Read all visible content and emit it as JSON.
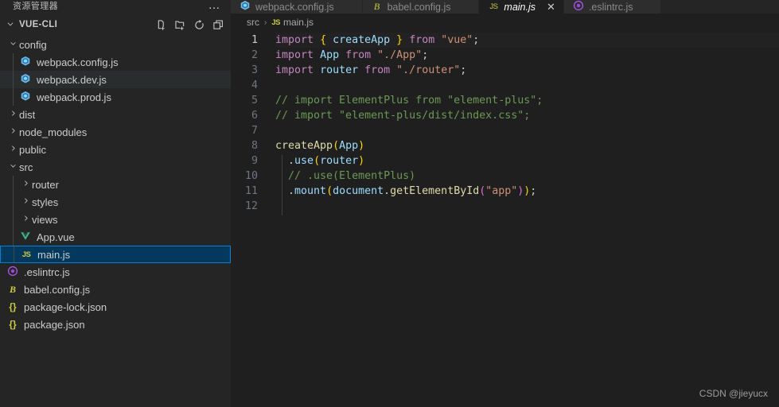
{
  "sidebar": {
    "title": "资源管理器",
    "more_label": "…",
    "project": {
      "name": "VUE-CLI",
      "expanded": true
    },
    "actions": [
      {
        "name": "new-file-icon",
        "label": "New File"
      },
      {
        "name": "new-folder-icon",
        "label": "New Folder"
      },
      {
        "name": "refresh-icon",
        "label": "Refresh Explorer"
      },
      {
        "name": "collapse-all-icon",
        "label": "Collapse Folders in Explorer"
      }
    ],
    "items": [
      {
        "label": "config",
        "type": "folder",
        "icon": "chevron-down",
        "depth": 1,
        "expanded": true,
        "state": "normal"
      },
      {
        "label": "webpack.config.js",
        "type": "file",
        "icon": "webpack",
        "depth": 2,
        "state": "normal"
      },
      {
        "label": "webpack.dev.js",
        "type": "file",
        "icon": "webpack",
        "depth": 2,
        "state": "hover"
      },
      {
        "label": "webpack.prod.js",
        "type": "file",
        "icon": "webpack",
        "depth": 2,
        "state": "normal"
      },
      {
        "label": "dist",
        "type": "folder",
        "icon": "chevron-right",
        "depth": 1,
        "expanded": false,
        "state": "normal"
      },
      {
        "label": "node_modules",
        "type": "folder",
        "icon": "chevron-right",
        "depth": 1,
        "expanded": false,
        "state": "normal"
      },
      {
        "label": "public",
        "type": "folder",
        "icon": "chevron-right",
        "depth": 1,
        "expanded": false,
        "state": "normal"
      },
      {
        "label": "src",
        "type": "folder",
        "icon": "chevron-down",
        "depth": 1,
        "expanded": true,
        "state": "normal"
      },
      {
        "label": "router",
        "type": "folder",
        "icon": "chevron-right",
        "depth": 2,
        "expanded": false,
        "state": "normal"
      },
      {
        "label": "styles",
        "type": "folder",
        "icon": "chevron-right",
        "depth": 2,
        "expanded": false,
        "state": "normal"
      },
      {
        "label": "views",
        "type": "folder",
        "icon": "chevron-right",
        "depth": 2,
        "expanded": false,
        "state": "normal"
      },
      {
        "label": "App.vue",
        "type": "file",
        "icon": "vue",
        "depth": 2,
        "state": "normal"
      },
      {
        "label": "main.js",
        "type": "file",
        "icon": "js",
        "depth": 2,
        "state": "selected"
      },
      {
        "label": ".eslintrc.js",
        "type": "file",
        "icon": "eslint",
        "depth": 1,
        "state": "normal"
      },
      {
        "label": "babel.config.js",
        "type": "file",
        "icon": "babel",
        "depth": 1,
        "state": "normal"
      },
      {
        "label": "package-lock.json",
        "type": "file",
        "icon": "json",
        "depth": 1,
        "state": "normal"
      },
      {
        "label": "package.json",
        "type": "file",
        "icon": "json",
        "depth": 1,
        "state": "normal"
      }
    ]
  },
  "tabs": [
    {
      "label": "webpack.config.js",
      "icon": "webpack",
      "active": false,
      "italic": false
    },
    {
      "label": "babel.config.js",
      "icon": "babel",
      "active": false,
      "italic": false
    },
    {
      "label": "main.js",
      "icon": "js",
      "active": true,
      "italic": true
    },
    {
      "label": ".eslintrc.js",
      "icon": "eslint",
      "active": false,
      "italic": false
    }
  ],
  "breadcrumb": {
    "folder": "src",
    "separator": "›",
    "file_icon_label": "JS",
    "file": "main.js"
  },
  "editor": {
    "filename": "main.js",
    "language": "javascript",
    "current_line": 1,
    "line_numbers": [
      "1",
      "2",
      "3",
      "4",
      "5",
      "6",
      "7",
      "8",
      "9",
      "10",
      "11",
      "12"
    ],
    "code_lines": [
      {
        "n": 1,
        "tokens": [
          {
            "t": "import",
            "c": "t-kw"
          },
          {
            "t": " ",
            "c": "t-punc"
          },
          {
            "t": "{",
            "c": "t-brace"
          },
          {
            "t": " ",
            "c": "t-punc"
          },
          {
            "t": "createApp",
            "c": "t-var"
          },
          {
            "t": " ",
            "c": "t-punc"
          },
          {
            "t": "}",
            "c": "t-brace"
          },
          {
            "t": " ",
            "c": "t-punc"
          },
          {
            "t": "from",
            "c": "t-from"
          },
          {
            "t": " ",
            "c": "t-punc"
          },
          {
            "t": "\"vue\"",
            "c": "t-str"
          },
          {
            "t": ";",
            "c": "t-semi"
          }
        ]
      },
      {
        "n": 2,
        "tokens": [
          {
            "t": "import",
            "c": "t-kw"
          },
          {
            "t": " ",
            "c": "t-punc"
          },
          {
            "t": "App",
            "c": "t-var"
          },
          {
            "t": " ",
            "c": "t-punc"
          },
          {
            "t": "from",
            "c": "t-from"
          },
          {
            "t": " ",
            "c": "t-punc"
          },
          {
            "t": "\"./App\"",
            "c": "t-str"
          },
          {
            "t": ";",
            "c": "t-semi"
          }
        ]
      },
      {
        "n": 3,
        "tokens": [
          {
            "t": "import",
            "c": "t-kw"
          },
          {
            "t": " ",
            "c": "t-punc"
          },
          {
            "t": "router",
            "c": "t-var"
          },
          {
            "t": " ",
            "c": "t-punc"
          },
          {
            "t": "from",
            "c": "t-from"
          },
          {
            "t": " ",
            "c": "t-punc"
          },
          {
            "t": "\"./router\"",
            "c": "t-str"
          },
          {
            "t": ";",
            "c": "t-semi"
          }
        ]
      },
      {
        "n": 4,
        "tokens": []
      },
      {
        "n": 5,
        "tokens": [
          {
            "t": "// import ElementPlus from \"element-plus\";",
            "c": "t-comment"
          }
        ]
      },
      {
        "n": 6,
        "tokens": [
          {
            "t": "// import \"element-plus/dist/index.css\";",
            "c": "t-comment"
          }
        ]
      },
      {
        "n": 7,
        "tokens": []
      },
      {
        "n": 8,
        "tokens": [
          {
            "t": "createApp",
            "c": "t-func"
          },
          {
            "t": "(",
            "c": "t-brace"
          },
          {
            "t": "App",
            "c": "t-var"
          },
          {
            "t": ")",
            "c": "t-brace"
          }
        ]
      },
      {
        "n": 9,
        "tokens": [
          {
            "t": "  .",
            "c": "t-punc"
          },
          {
            "t": "use",
            "c": "t-prop"
          },
          {
            "t": "(",
            "c": "t-brace"
          },
          {
            "t": "router",
            "c": "t-var"
          },
          {
            "t": ")",
            "c": "t-brace"
          }
        ]
      },
      {
        "n": 10,
        "tokens": [
          {
            "t": "  // .use(ElementPlus)",
            "c": "t-comment"
          }
        ]
      },
      {
        "n": 11,
        "tokens": [
          {
            "t": "  .",
            "c": "t-punc"
          },
          {
            "t": "mount",
            "c": "t-prop"
          },
          {
            "t": "(",
            "c": "t-brace"
          },
          {
            "t": "document",
            "c": "t-var"
          },
          {
            "t": ".",
            "c": "t-punc"
          },
          {
            "t": "getElementById",
            "c": "t-func"
          },
          {
            "t": "(",
            "c": "t-brace2"
          },
          {
            "t": "\"app\"",
            "c": "t-str"
          },
          {
            "t": ")",
            "c": "t-brace2"
          },
          {
            "t": ")",
            "c": "t-brace"
          },
          {
            "t": ";",
            "c": "t-semi"
          }
        ]
      },
      {
        "n": 12,
        "tokens": []
      }
    ]
  },
  "watermark": "CSDN @jieyucx",
  "colors": {
    "sidebar_bg": "#252526",
    "editor_bg": "#1f1f1f",
    "tab_inactive_bg": "#2d2d2d",
    "selection_bg": "#04395e",
    "selection_border": "#007fd4",
    "hover_bg": "#2a2d2e",
    "keyword": "#c586c0",
    "variable": "#9cdcfe",
    "string": "#ce9178",
    "comment": "#6a9955",
    "function": "#dcdcaa",
    "bracket": "#ffd700"
  }
}
